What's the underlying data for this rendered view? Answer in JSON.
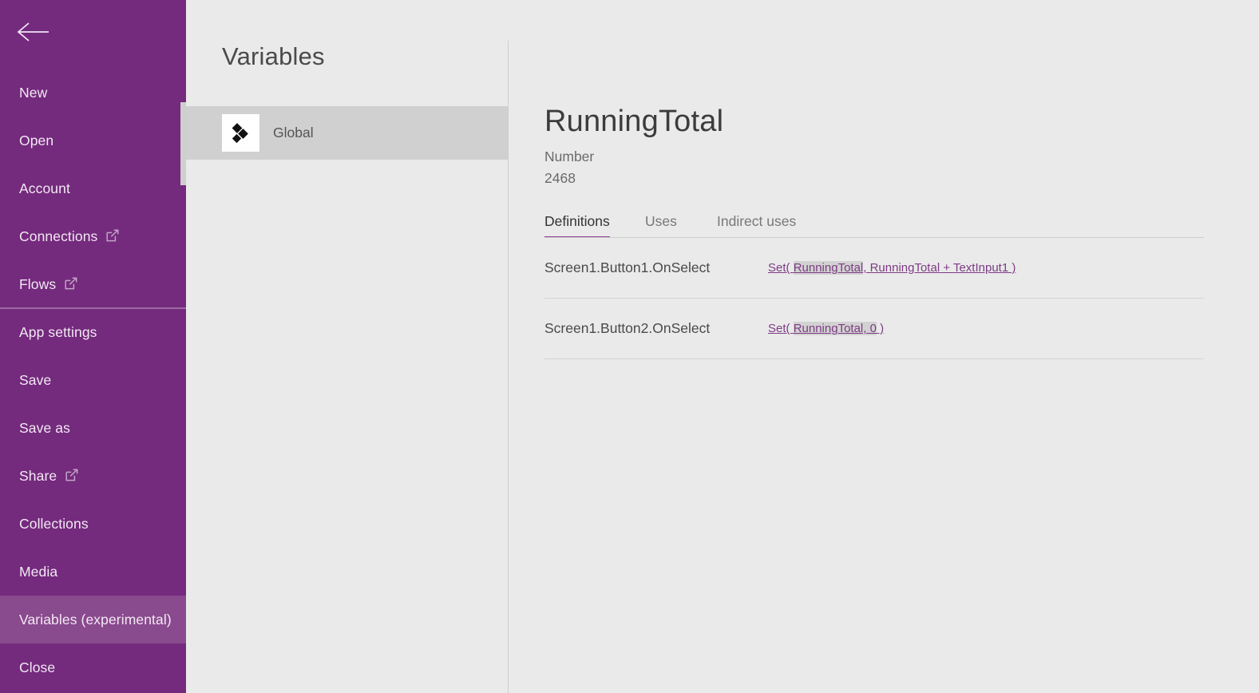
{
  "sidebar": {
    "back_icon": "back-arrow-icon",
    "accent_color": "#742a7d",
    "selected_color": "#8a4a8e",
    "items": [
      {
        "label": "New",
        "external": false,
        "selected": false,
        "divider_above": false
      },
      {
        "label": "Open",
        "external": false,
        "selected": false,
        "divider_above": false
      },
      {
        "label": "Account",
        "external": false,
        "selected": false,
        "divider_above": false
      },
      {
        "label": "Connections",
        "external": true,
        "selected": false,
        "divider_above": false
      },
      {
        "label": "Flows",
        "external": true,
        "selected": false,
        "divider_above": false
      },
      {
        "label": "App settings",
        "external": false,
        "selected": false,
        "divider_above": true
      },
      {
        "label": "Save",
        "external": false,
        "selected": false,
        "divider_above": false
      },
      {
        "label": "Save as",
        "external": false,
        "selected": false,
        "divider_above": false
      },
      {
        "label": "Share",
        "external": true,
        "selected": false,
        "divider_above": false
      },
      {
        "label": "Collections",
        "external": false,
        "selected": false,
        "divider_above": false
      },
      {
        "label": "Media",
        "external": false,
        "selected": false,
        "divider_above": false
      },
      {
        "label": "Variables (experimental)",
        "external": false,
        "selected": true,
        "divider_above": false
      },
      {
        "label": "Close",
        "external": false,
        "selected": false,
        "divider_above": false
      }
    ]
  },
  "midpane": {
    "title": "Variables",
    "scopes": [
      {
        "label": "Global",
        "icon": "global-variables-icon",
        "selected": true
      }
    ]
  },
  "detail": {
    "variable_name": "RunningTotal",
    "variable_type": "Number",
    "variable_value": "2468",
    "tabs": [
      {
        "label": "Definitions",
        "active": true
      },
      {
        "label": "Uses",
        "active": false
      },
      {
        "label": "Indirect uses",
        "active": false
      }
    ],
    "definitions": [
      {
        "target": "Screen1.Button1.OnSelect",
        "formula_prefix": "Set( ",
        "formula_highlight": "RunningTotal",
        "formula_suffix": ", RunningTotal + TextInput1 )"
      },
      {
        "target": "Screen1.Button2.OnSelect",
        "formula_prefix": "Set( ",
        "formula_highlight": "RunningTotal, 0",
        "formula_suffix": " )"
      }
    ]
  }
}
